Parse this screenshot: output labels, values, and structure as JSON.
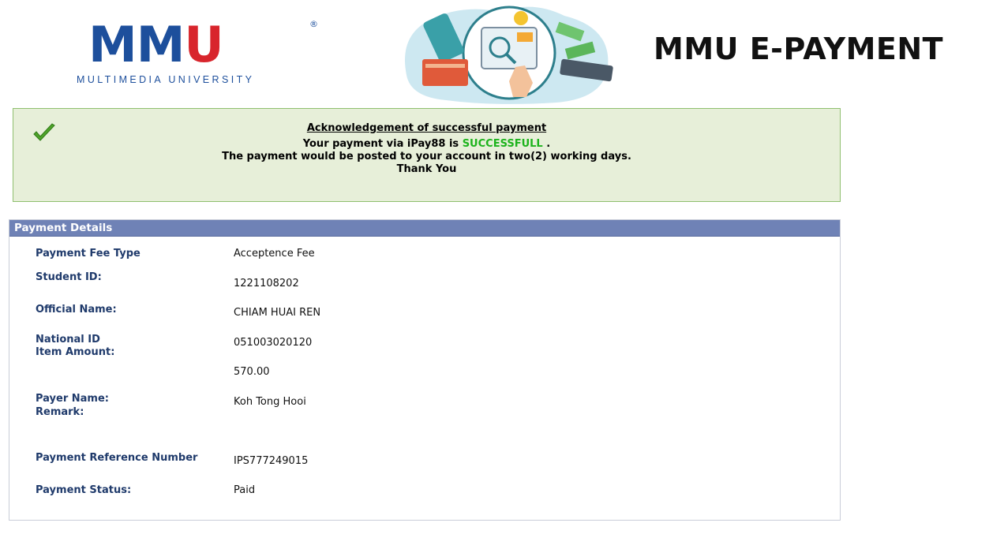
{
  "header": {
    "logo_word_main": "MM",
    "logo_word_u": "U",
    "logo_registered": "®",
    "logo_subtitle": "MULTIMEDIA UNIVERSITY",
    "brand_title": "MMU E-PAYMENT",
    "icons": [
      "mmu-logo",
      "payment-illustration"
    ]
  },
  "acknowledgement": {
    "title": "Acknowledgement of successful payment",
    "line1_prefix": "Your payment via iPay88 is",
    "status_word": "SUCCESSFULL",
    "line1_suffix": ".",
    "line2": "The payment would be posted to your account in two(2) working days.",
    "line3": "Thank You",
    "icon": "checkmark-icon"
  },
  "payment_details": {
    "header": "Payment Details",
    "labels": {
      "fee_type": "Payment Fee Type",
      "student_id": "Student ID:",
      "official_name": "Official Name:",
      "national_id": "National ID",
      "item_amount": "Item Amount:",
      "payer_name": "Payer Name:",
      "remark": "Remark:",
      "reference_number": "Payment Reference Number",
      "status": "Payment Status:"
    },
    "values": {
      "fee_type": "Acceptence Fee",
      "student_id": "1221108202",
      "official_name": "CHIAM HUAI REN",
      "national_id": "051003020120",
      "item_amount": "570.00",
      "payer_name": "Koh Tong Hooi",
      "reference_number": "IPS777249015",
      "status": "Paid"
    }
  },
  "colors": {
    "brand_blue": "#1d4f9c",
    "brand_red": "#d8252c",
    "success_green": "#1db31d",
    "panel_header": "#6f82b6",
    "label_navy": "#1f3a6b",
    "success_bg": "#e7efd9"
  }
}
